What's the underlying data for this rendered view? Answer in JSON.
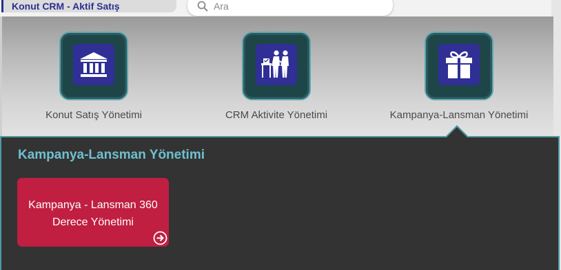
{
  "app": {
    "title": "Konut CRM - Aktif Satış"
  },
  "search": {
    "placeholder": "Ara",
    "icon": "search-icon"
  },
  "menu": {
    "items": [
      {
        "label": "Konut Satış Yönetimi",
        "icon": "bank-icon"
      },
      {
        "label": "CRM Aktivite Yönetimi",
        "icon": "meeting-handshake-icon"
      },
      {
        "label": "Kampanya-Lansman Yönetimi",
        "icon": "gift-icon",
        "selected": true
      }
    ]
  },
  "panel": {
    "title": "Kampanya-Lansman Yönetimi",
    "cards": [
      {
        "line1": "Kampanya - Lansman 360",
        "line2": "Derece Yönetimi",
        "icon": "arrow-circle-right-icon"
      }
    ]
  },
  "colors": {
    "brand": "#2c2f8f",
    "panel_bg": "#333333",
    "accent_teal": "#4f9aa5",
    "panel_title": "#6fc0d0",
    "card_red": "#c01f41",
    "icon_bg": "#2f2f96"
  }
}
